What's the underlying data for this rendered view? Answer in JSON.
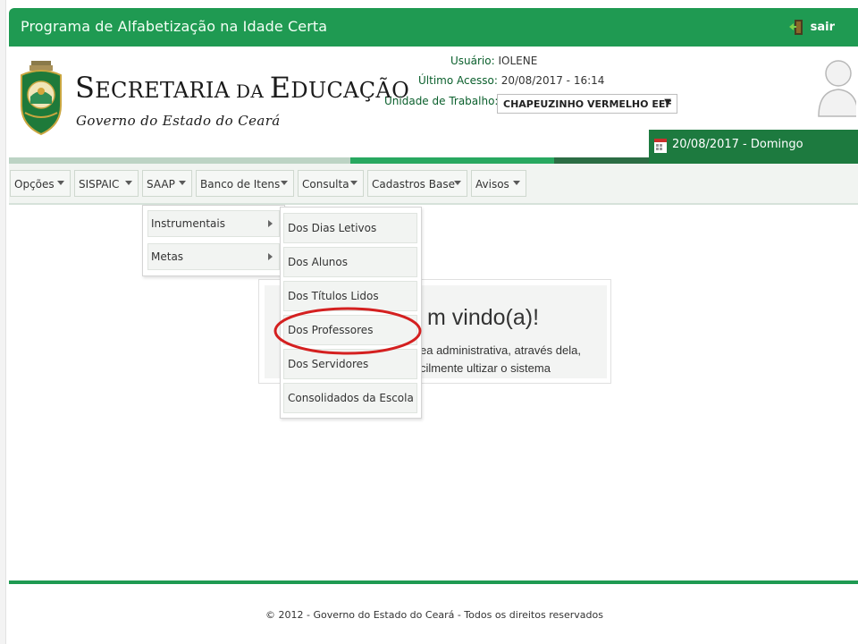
{
  "header": {
    "app_title": "Programa de Alfabetização na Idade Certa",
    "logout_label": "sair"
  },
  "brand": {
    "line1_big_s": "S",
    "line1_rest_1": "ECRETARIA",
    "line1_da": " DA ",
    "line1_big_e": "E",
    "line1_rest_2": "DUCAÇÃO",
    "line2": "Governo do Estado do Ceará"
  },
  "user": {
    "usuario_label": "Usuário:",
    "usuario_value": "IOLENE",
    "ultimo_acesso_label": "Último Acesso:",
    "ultimo_acesso_value": "20/08/2017 - 16:14",
    "unidade_label": "Unidade de Trabalho:",
    "unidade_value": "CHAPEUZINHO VERMELHO EEF"
  },
  "date_badge": "20/08/2017 - Domingo",
  "menu": [
    {
      "label": "Opções"
    },
    {
      "label": "SISPAIC"
    },
    {
      "label": "SAAP"
    },
    {
      "label": "Banco de Itens"
    },
    {
      "label": "Consulta"
    },
    {
      "label": "Cadastros Base"
    },
    {
      "label": "Avisos"
    }
  ],
  "saap_submenu": [
    {
      "label": "Instrumentais"
    },
    {
      "label": "Metas"
    }
  ],
  "instrumentais_submenu": [
    {
      "label": "Dos Dias Letivos"
    },
    {
      "label": "Dos Alunos"
    },
    {
      "label": "Dos Títulos Lidos"
    },
    {
      "label": "Dos Professores"
    },
    {
      "label": "Dos Servidores"
    },
    {
      "label": "Consolidados da Escola"
    }
  ],
  "welcome": {
    "title": "m vindo(a)!",
    "line1": "ea administrativa, através dela,",
    "line2": "cilmente ultizar o sistema"
  },
  "footer": "© 2012 - Governo do Estado do Ceará - Todos os direitos reservados",
  "colors": {
    "brand_green": "#1f9a52",
    "dark_green": "#1d7a3f",
    "highlight_red": "#d42020"
  }
}
